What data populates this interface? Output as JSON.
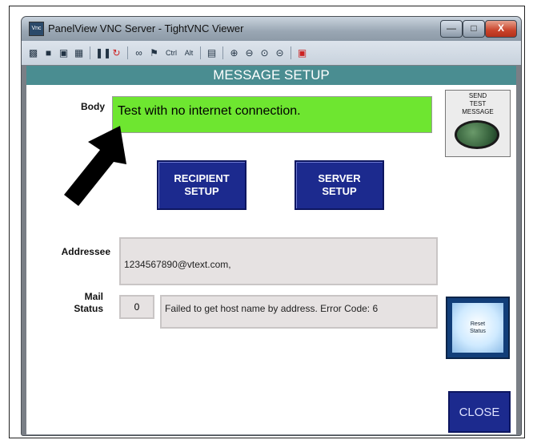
{
  "window": {
    "title": "PanelView VNC Server - TightVNC Viewer",
    "min_icon": "minimize-icon",
    "max_icon": "maximize-icon",
    "close_label": "X"
  },
  "toolbar": {
    "ctrl_label": "Ctrl",
    "alt_label": "Alt"
  },
  "screen": {
    "header": "MESSAGE SETUP",
    "body_label": "Body",
    "body_value": "Test with no internet connection.",
    "send_label": "SEND\nTEST\nMESSAGE",
    "recipient_button": "RECIPIENT\nSETUP",
    "server_button": "SERVER\nSETUP",
    "addressee_label": "Addressee",
    "addressee_value": "1234567890@vtext.com,",
    "mail_label": "Mail",
    "status_label": "Status",
    "status_code": "0",
    "status_message": "Failed to get host name by address. Error Code: 6",
    "reset_label": "Reset\nStatus",
    "close_label": "CLOSE"
  },
  "colors": {
    "header": "#4a8d91",
    "body_field": "#6ee630",
    "button_blue": "#1c2a8e"
  }
}
